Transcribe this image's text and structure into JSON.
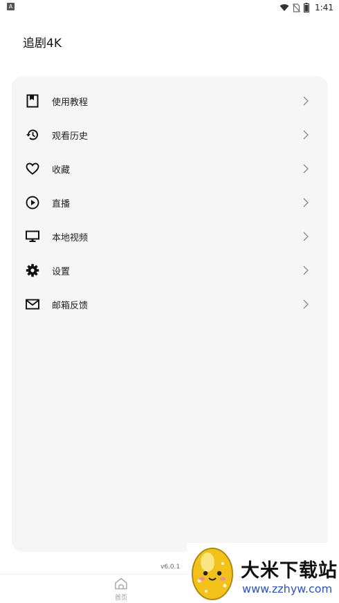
{
  "status_bar": {
    "left_badge": "A",
    "time": "1:41",
    "icons": [
      "wifi-icon",
      "no-sim-icon",
      "battery-icon"
    ]
  },
  "app": {
    "title": "追剧4K"
  },
  "menu": {
    "items": [
      {
        "label": "使用教程",
        "icon": "bookmark-icon"
      },
      {
        "label": "观看历史",
        "icon": "history-icon"
      },
      {
        "label": "收藏",
        "icon": "heart-icon"
      },
      {
        "label": "直播",
        "icon": "play-circle-icon"
      },
      {
        "label": "本地视频",
        "icon": "monitor-icon"
      },
      {
        "label": "设置",
        "icon": "gear-icon"
      },
      {
        "label": "邮箱反馈",
        "icon": "mail-icon"
      }
    ]
  },
  "version": "v6.0.1",
  "bottom_nav": {
    "home_label": "首页"
  },
  "watermark": {
    "title": "大米下载站",
    "url": "www.zzhyw.com"
  }
}
